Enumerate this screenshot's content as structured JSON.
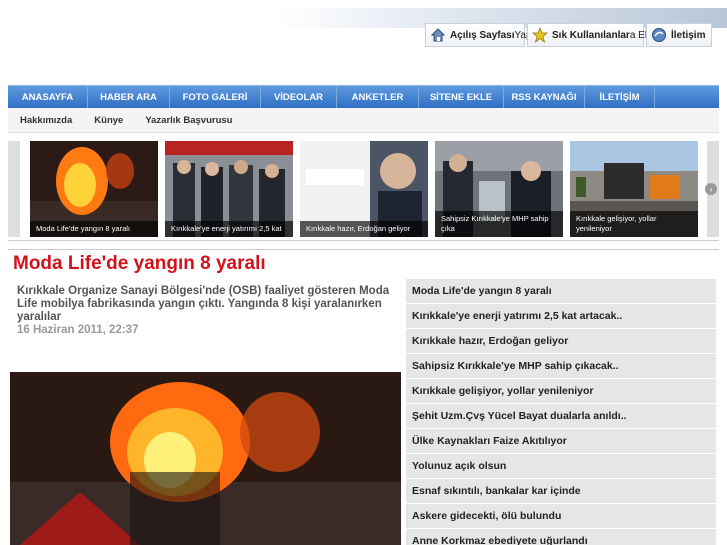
{
  "header": {
    "links": [
      {
        "label_bold": "Açılış Sayfası",
        "label_light": " Yap",
        "icon": "home-icon"
      },
      {
        "label_bold": "Sık Kullanılanlar",
        "label_light": "a Ekle",
        "icon": "star-icon"
      },
      {
        "label_bold": "İletişim",
        "label_light": "",
        "icon": "contact-icon"
      }
    ]
  },
  "nav": {
    "items": [
      "ANASAYFA",
      "HABER ARA",
      "FOTO GALERİ",
      "VİDEOLAR",
      "ANKETLER",
      "SİTENE EKLE",
      "RSS KAYNAĞI",
      "İLETİŞİM"
    ]
  },
  "subnav": {
    "items": [
      "Hakkımızda",
      "Künye",
      "Yazarlık Başvurusu"
    ]
  },
  "slider": {
    "slides": [
      {
        "caption": "Moda Life'de yangın 8 yaralı"
      },
      {
        "caption": "Kırıkkale'ye enerji yatırımı 2,5 kat"
      },
      {
        "caption": "Kırıkkale hazır, Erdoğan geliyor"
      },
      {
        "caption": "Sahipsiz Kırıkkale'ye MHP sahip çıka"
      },
      {
        "caption": "Kırıkkale gelişiyor, yollar yenileniyor"
      }
    ]
  },
  "article": {
    "title": "Moda Life'de yangın 8 yaralı",
    "summary": "Kırıkkale Organize Sanayi Bölgesi'nde (OSB) faaliyet gösteren Moda Life mobilya fabrikasında yangın çıktı. Yangında 8 kişi yaralanırken yaralılar",
    "date": "16 Haziran 2011, 22:37"
  },
  "news_list": [
    "Moda Life'de yangın 8 yaralı",
    "Kırıkkale'ye enerji yatırımı 2,5 kat artacak..",
    "Kırıkkale hazır, Erdoğan geliyor",
    "Sahipsiz Kırıkkale'ye MHP sahip çıkacak..",
    "Kırıkkale gelişiyor, yollar yenileniyor",
    "Şehit Uzm.Çvş Yücel Bayat dualarla anıldı..",
    "Ülke Kaynakları Faize Akıtılıyor",
    "Yolunuz açık olsun",
    "Esnaf sıkıntılı, bankalar kar içinde",
    "Askere gidecekti, ölü bulundu",
    "Anne Korkmaz ebediyete uğurlandı"
  ]
}
